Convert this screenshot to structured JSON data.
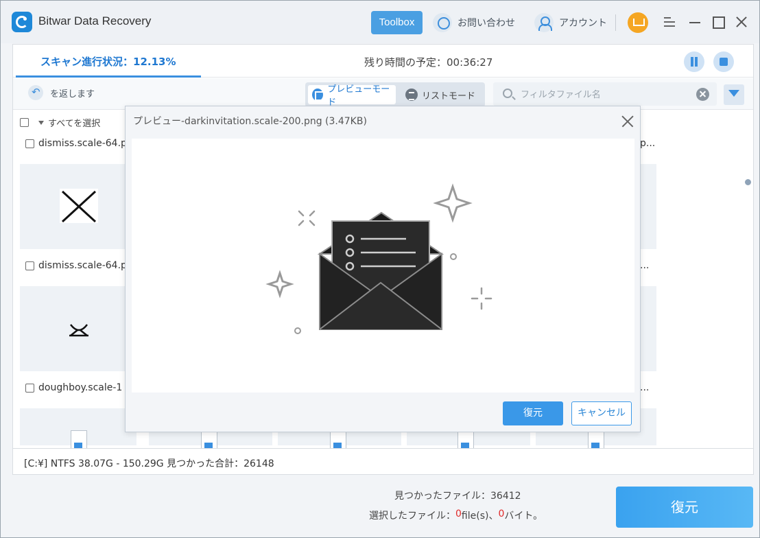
{
  "app": {
    "title": "Bitwar Data Recovery"
  },
  "header": {
    "toolbox_label": "Toolbox",
    "contact_label": "お問い合わせ",
    "account_label": "アカウント"
  },
  "scan": {
    "progress_label": "スキャン進行状況：12.13%",
    "progress_percent": 12.13,
    "remaining_label": "残り時間の予定：00:36:27"
  },
  "toolbar": {
    "back_label": "を返します",
    "preview_mode_label": "プレビューモード",
    "list_mode_label": "リストモード",
    "filter_placeholder": "フィルタファイル名"
  },
  "grid": {
    "select_all_label": "すべてを選択",
    "files": [
      {
        "name": "dismiss.scale-64.p"
      },
      {
        "name": "dismiss.scale-64.p"
      },
      {
        "name": "doughboy.scale-1"
      }
    ],
    "right_truncated": [
      "p...",
      "...",
      "..."
    ]
  },
  "status_bar": {
    "text": "[C:¥] NTFS 38.07G - 150.29G 見つかった合計：26148"
  },
  "bottom": {
    "found_label": "見つかったファイル：36412",
    "selected_prefix": "選択したファイル：",
    "selected_files_count": "0",
    "selected_files_unit": "file(s)、",
    "selected_bytes_count": "0",
    "selected_bytes_unit": "バイト。",
    "recover_label": "復元"
  },
  "dialog": {
    "title": "プレビュー-darkinvitation.scale-200.png (3.47KB)",
    "recover_label": "復元",
    "cancel_label": "キャンセル"
  },
  "icons": {
    "logo": "bitwar-logo-icon",
    "contact": "headset-icon",
    "account": "user-icon",
    "cart": "cart-icon"
  },
  "colors": {
    "accent": "#3a8fdf",
    "accent_text": "#1f78d1",
    "red": "#e02a2a",
    "cart": "#f5a623"
  }
}
